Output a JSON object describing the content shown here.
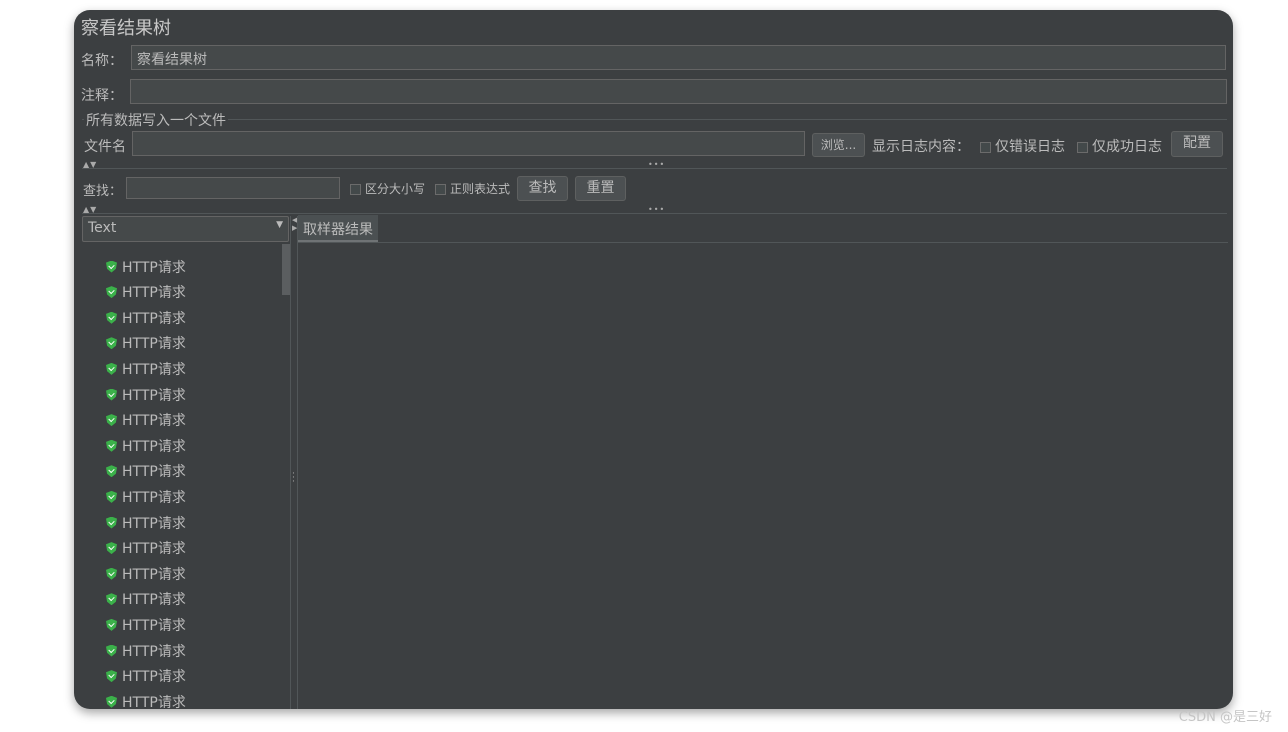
{
  "title": "察看结果树",
  "name_label": "名称：",
  "name_value": "察看结果树",
  "comment_label": "注释：",
  "comment_value": "",
  "file_group": "所有数据写入一个文件",
  "file_label": "文件名",
  "file_value": "",
  "browse": "浏览...",
  "log_label": "显示日志内容：",
  "errors_only": "仅错误日志",
  "success_only": "仅成功日志",
  "configure": "配置",
  "search_label": "查找：",
  "search_value": "",
  "case_sensitive": "区分大小写",
  "regex": "正则表达式",
  "find": "查找",
  "reset": "重置",
  "renderer": "Text",
  "tab": "取样器结果",
  "items": [
    "HTTP请求",
    "HTTP请求",
    "HTTP请求",
    "HTTP请求",
    "HTTP请求",
    "HTTP请求",
    "HTTP请求",
    "HTTP请求",
    "HTTP请求",
    "HTTP请求",
    "HTTP请求",
    "HTTP请求",
    "HTTP请求",
    "HTTP请求",
    "HTTP请求",
    "HTTP请求",
    "HTTP请求",
    "HTTP请求"
  ],
  "item_status": "success",
  "watermark": "CSDN @是三好"
}
